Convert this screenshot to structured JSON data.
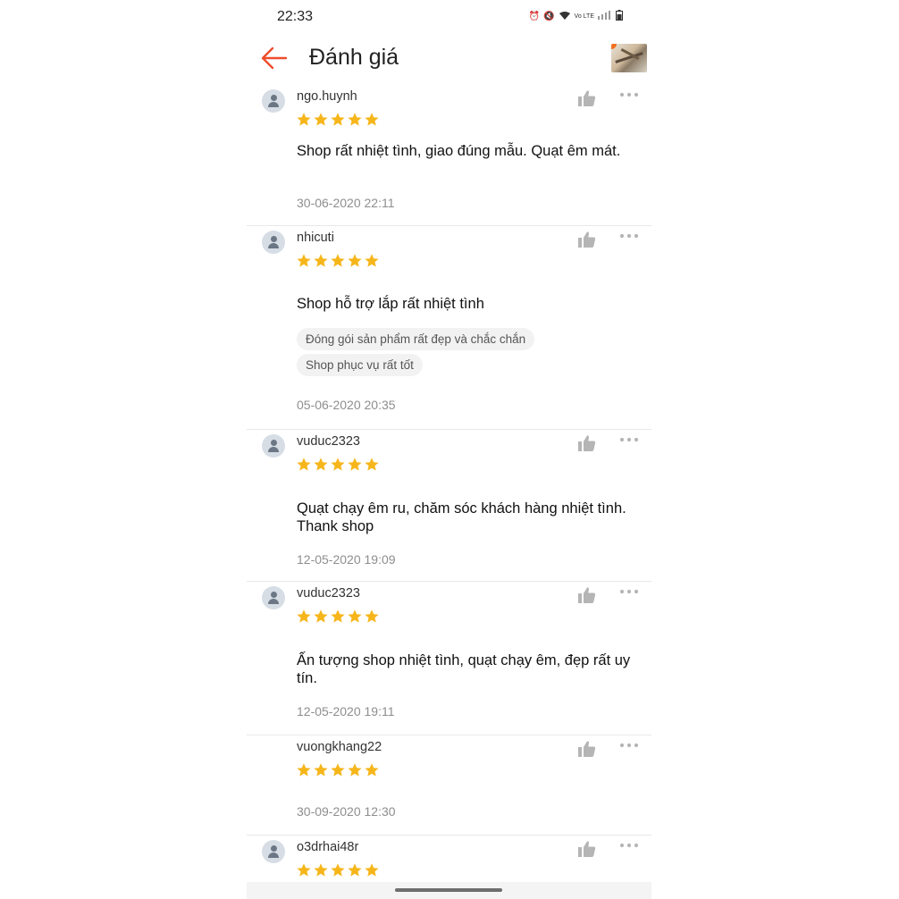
{
  "status_bar": {
    "time": "22:33",
    "icons": [
      "alarm-icon",
      "mute-icon",
      "wifi-icon",
      "volte-icon",
      "signal-icon",
      "battery-icon"
    ]
  },
  "header": {
    "title": "Đánh giá",
    "back_icon": "arrow-left-icon",
    "accent": "#ee4d2d"
  },
  "star_color": "#f6b61b",
  "reviews": [
    {
      "user": "ngo.huynh",
      "rating": 5,
      "text": "Shop rất nhiệt tình,  giao đúng mẫu.  Quạt êm mát.",
      "tags": [],
      "date": "30-06-2020 22:11"
    },
    {
      "user": "nhicuti",
      "rating": 5,
      "text": "Shop hỗ trợ lắp rất nhiệt tình",
      "tags": [
        "Đóng gói sản phẩm rất đẹp và chắc chắn",
        "Shop phục vụ rất tốt"
      ],
      "date": "05-06-2020 20:35"
    },
    {
      "user": "vuduc2323",
      "rating": 5,
      "text": "Quạt chạy êm ru, chăm sóc khách hàng nhiệt tình. Thank shop",
      "tags": [],
      "date": "12-05-2020 19:09"
    },
    {
      "user": "vuduc2323",
      "rating": 5,
      "text": "Ấn tượng shop nhiệt tình, quạt chạy êm, đẹp rất uy tín.",
      "tags": [],
      "date": "12-05-2020 19:11"
    },
    {
      "user": "vuongkhang22",
      "rating": 5,
      "text": "",
      "tags": [],
      "date": "30-09-2020 12:30"
    },
    {
      "user": "o3drhai48r",
      "rating": 5,
      "text": "",
      "tags": [],
      "date": ""
    }
  ]
}
